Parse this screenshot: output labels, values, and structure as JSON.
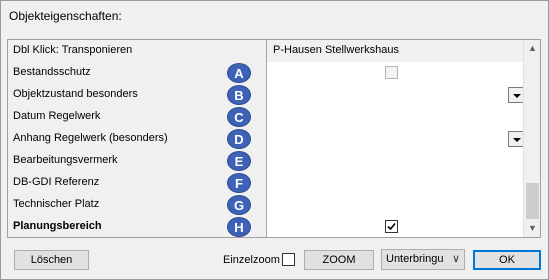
{
  "window": {
    "title": "Objekteigenschaften:"
  },
  "grid": {
    "header": {
      "label": "Dbl Klick: Transponieren",
      "value": "P-Hausen Stellwerkshaus"
    },
    "rows": [
      {
        "label": "Bestandsschutz",
        "badge": "A"
      },
      {
        "label": "Objektzustand besonders",
        "badge": "B"
      },
      {
        "label": "Datum Regelwerk",
        "badge": "C"
      },
      {
        "label": "Anhang Regelwerk (besonders)",
        "badge": "D"
      },
      {
        "label": "Bearbeitungsvermerk",
        "badge": "E"
      },
      {
        "label": "DB-GDI Referenz",
        "badge": "F"
      },
      {
        "label": "Technischer Platz",
        "badge": "G"
      },
      {
        "label": "Planungsbereich",
        "badge": "H",
        "checked": true
      }
    ]
  },
  "footer": {
    "delete_label": "Löschen",
    "einzelzoom_label": "Einzelzoom",
    "zoom_label": "ZOOM",
    "combo_value": "Unterbringu",
    "ok_label": "OK"
  },
  "colors": {
    "badge": "#3e63b6",
    "focus": "#0078d7"
  }
}
